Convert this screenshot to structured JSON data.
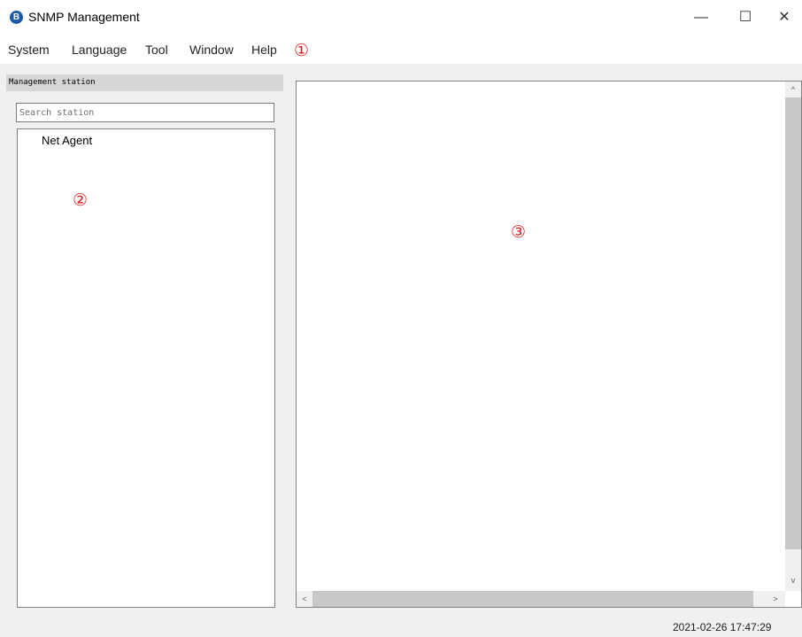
{
  "window": {
    "title": "SNMP Management",
    "app_icon_glyph": "B",
    "minimize_glyph": "—",
    "maximize_glyph": "☐",
    "close_glyph": "✕"
  },
  "menu": {
    "items": [
      "System",
      "Language",
      "Tool",
      "Window",
      "Help"
    ]
  },
  "annotations": [
    "①",
    "②",
    "③"
  ],
  "left_panel": {
    "header": "Management station",
    "search_placeholder": "Search station",
    "tree_items": [
      "Net Agent"
    ]
  },
  "scrollbars": {
    "up_glyph": "^",
    "down_glyph": "v",
    "left_glyph": "<",
    "right_glyph": ">"
  },
  "status": {
    "datetime": "2021-02-26 17:47:29"
  },
  "colors": {
    "accent_annotation": "#d81e1e",
    "app_icon": "#1a5aa8"
  }
}
